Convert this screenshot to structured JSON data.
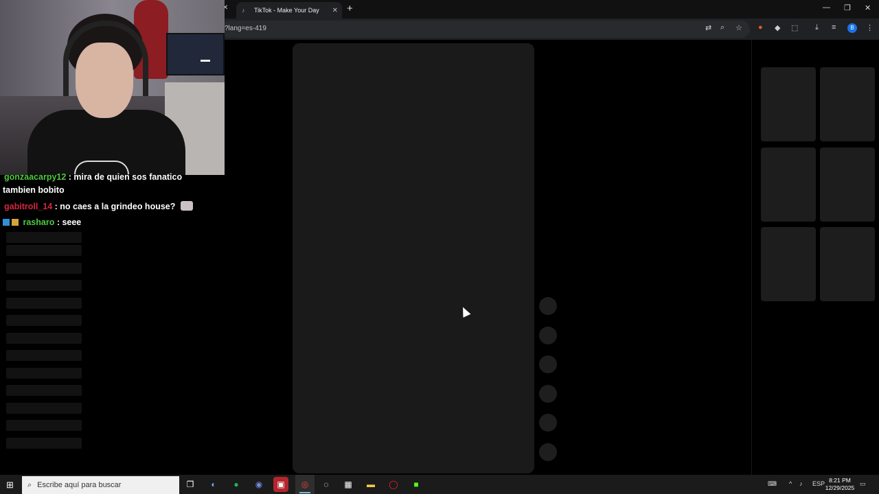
{
  "browser": {
    "tab_title": "TikTok - Make Your Day",
    "url_fragment": "?lang=es-419",
    "close_glyph": "✕",
    "new_tab_glyph": "+",
    "profile_initial": "B"
  },
  "window_controls": {
    "minimize": "—",
    "restore": "❐",
    "close": "✕"
  },
  "chat": {
    "messages": [
      {
        "user": "gonzaacarpy12",
        "user_color": "#4ecb3f",
        "text": " : mira de quien sos fanatico",
        "continuation": "tambien bobito"
      },
      {
        "user": "gabitroll_14",
        "user_color": "#d6253f",
        "text": " : no caes a la grindeo house?"
      },
      {
        "user": "rasharo",
        "user_color": "#4ecb3f",
        "text": " : seee"
      }
    ]
  },
  "taskbar": {
    "search_placeholder": "Escribe aquí para buscar",
    "language": "ESP",
    "time": "8:21 PM",
    "date": "12/29/2025"
  },
  "colors": {
    "skeleton": "#1a1a1a",
    "page_bg": "#000000",
    "chrome_bg": "#202124"
  }
}
